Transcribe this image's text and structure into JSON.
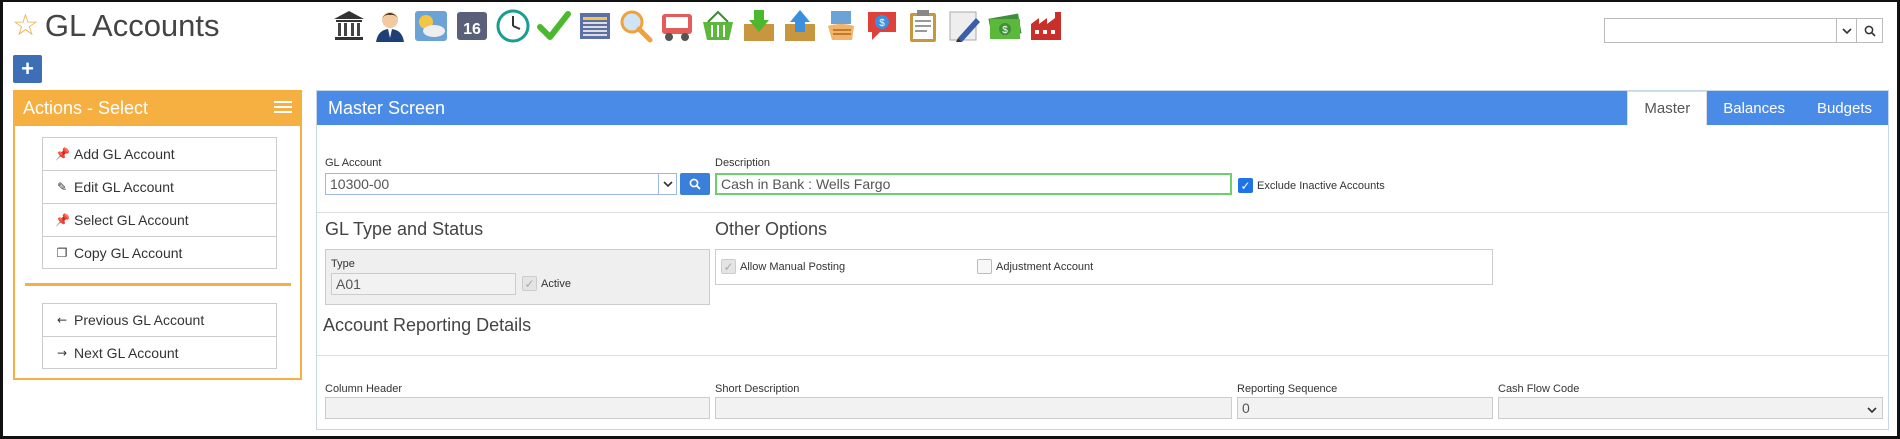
{
  "header": {
    "title": "GL Accounts",
    "star_icon": "star-outline-icon",
    "accent": "#f0ad4e"
  },
  "toolbar": {
    "icons": [
      "bank-icon",
      "user-icon",
      "weather-icon",
      "calendar-16-icon",
      "clock-icon",
      "checkmark-icon",
      "document-icon",
      "magnifier-icon",
      "truck-icon",
      "basket-icon",
      "download-box-icon",
      "upload-box-icon",
      "hand-card-icon",
      "dollar-speech-icon",
      "clipboard-icon",
      "pencil-paper-icon",
      "money-icon",
      "factory-icon"
    ],
    "calendar_day": "16"
  },
  "top_search": {
    "value": ""
  },
  "actions": {
    "title": "Actions - Select",
    "color": "#f5b041",
    "group1": [
      {
        "label": "Add GL Account",
        "icon": "pin-icon"
      },
      {
        "label": "Edit GL Account",
        "icon": "pencil-icon"
      },
      {
        "label": "Select GL Account",
        "icon": "pin-icon"
      },
      {
        "label": "Copy GL Account",
        "icon": "copy-icon"
      }
    ],
    "group2": [
      {
        "label": "Previous GL Account",
        "icon": "arrow-left-icon"
      },
      {
        "label": "Next GL Account",
        "icon": "arrow-right-icon"
      }
    ]
  },
  "main": {
    "title": "Master Screen",
    "color": "#4b8be8",
    "tabs": [
      {
        "label": "Master",
        "active": true
      },
      {
        "label": "Balances",
        "active": false
      },
      {
        "label": "Budgets",
        "active": false
      }
    ],
    "gl_account": {
      "label": "GL Account",
      "value": "10300-00"
    },
    "description": {
      "label": "Description",
      "value": "Cash in Bank : Wells Fargo"
    },
    "exclude_inactive": {
      "label": "Exclude Inactive Accounts",
      "checked": true
    },
    "gl_type_section": "GL Type and Status",
    "type": {
      "label": "Type",
      "value": "A01"
    },
    "active": {
      "label": "Active",
      "checked": true
    },
    "other_options_section": "Other Options",
    "allow_manual_posting": {
      "label": "Allow Manual Posting",
      "checked": true
    },
    "adjustment_account": {
      "label": "Adjustment Account",
      "checked": false
    },
    "reporting_section": "Account Reporting Details",
    "column_header": {
      "label": "Column Header",
      "value": ""
    },
    "short_description": {
      "label": "Short Description",
      "value": ""
    },
    "reporting_sequence": {
      "label": "Reporting Sequence",
      "value": "0"
    },
    "cash_flow_code": {
      "label": "Cash Flow Code",
      "value": ""
    }
  }
}
